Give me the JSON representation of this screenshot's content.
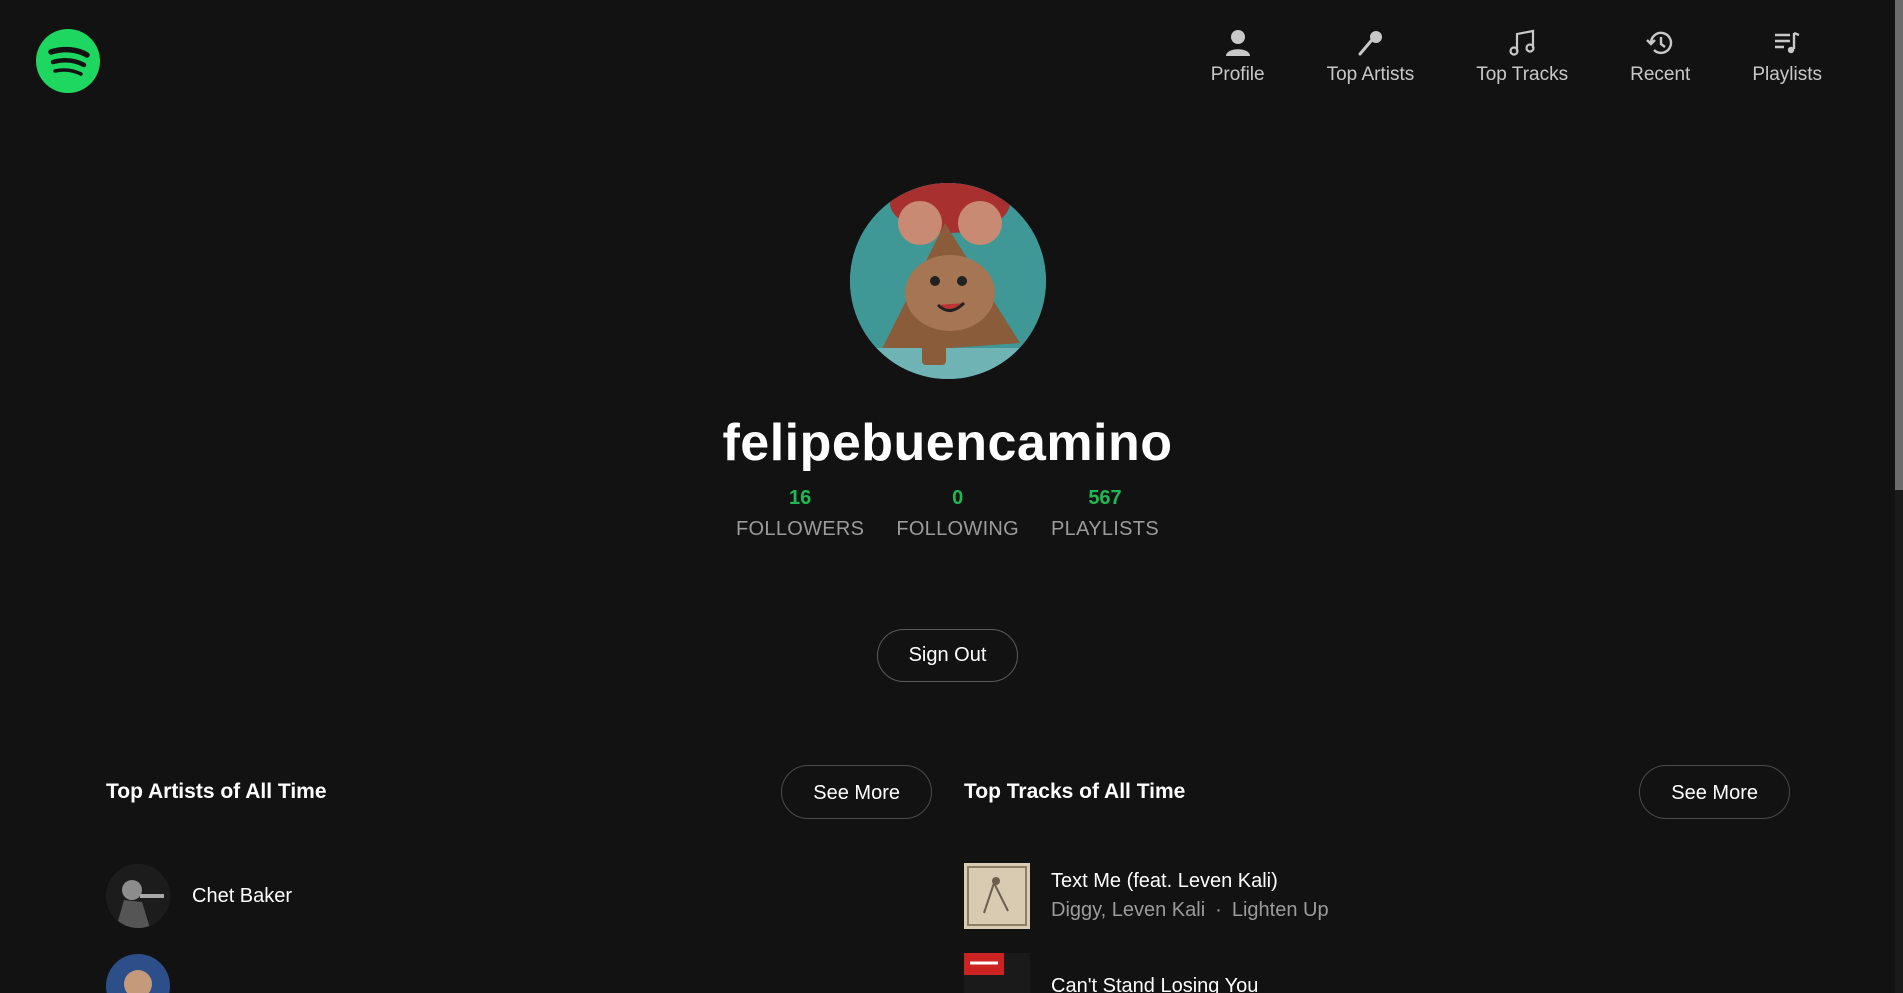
{
  "brand": {
    "logo_icon": "spotify-logo-icon",
    "accent": "#1db954",
    "logo_color": "#1ed760"
  },
  "nav": [
    {
      "label": "Profile",
      "icon": "user-icon"
    },
    {
      "label": "Top Artists",
      "icon": "microphone-icon"
    },
    {
      "label": "Top Tracks",
      "icon": "music-note-icon"
    },
    {
      "label": "Recent",
      "icon": "history-icon"
    },
    {
      "label": "Playlists",
      "icon": "playlist-icon"
    }
  ],
  "profile": {
    "username": "felipebuencamino",
    "stats": [
      {
        "value": "16",
        "label": "FOLLOWERS"
      },
      {
        "value": "0",
        "label": "FOLLOWING"
      },
      {
        "value": "567",
        "label": "PLAYLISTS"
      }
    ],
    "signout_label": "Sign Out"
  },
  "top_artists": {
    "title": "Top Artists of All Time",
    "see_more_label": "See More",
    "items": [
      {
        "name": "Chet Baker"
      },
      {
        "name": ""
      }
    ]
  },
  "top_tracks": {
    "title": "Top Tracks of All Time",
    "see_more_label": "See More",
    "items": [
      {
        "title": "Text Me (feat. Leven Kali)",
        "artists": "Diggy, Leven Kali",
        "separator": "·",
        "album": "Lighten Up"
      },
      {
        "title": "Can't Stand Losing You",
        "artists": "",
        "separator": "",
        "album": ""
      }
    ]
  }
}
